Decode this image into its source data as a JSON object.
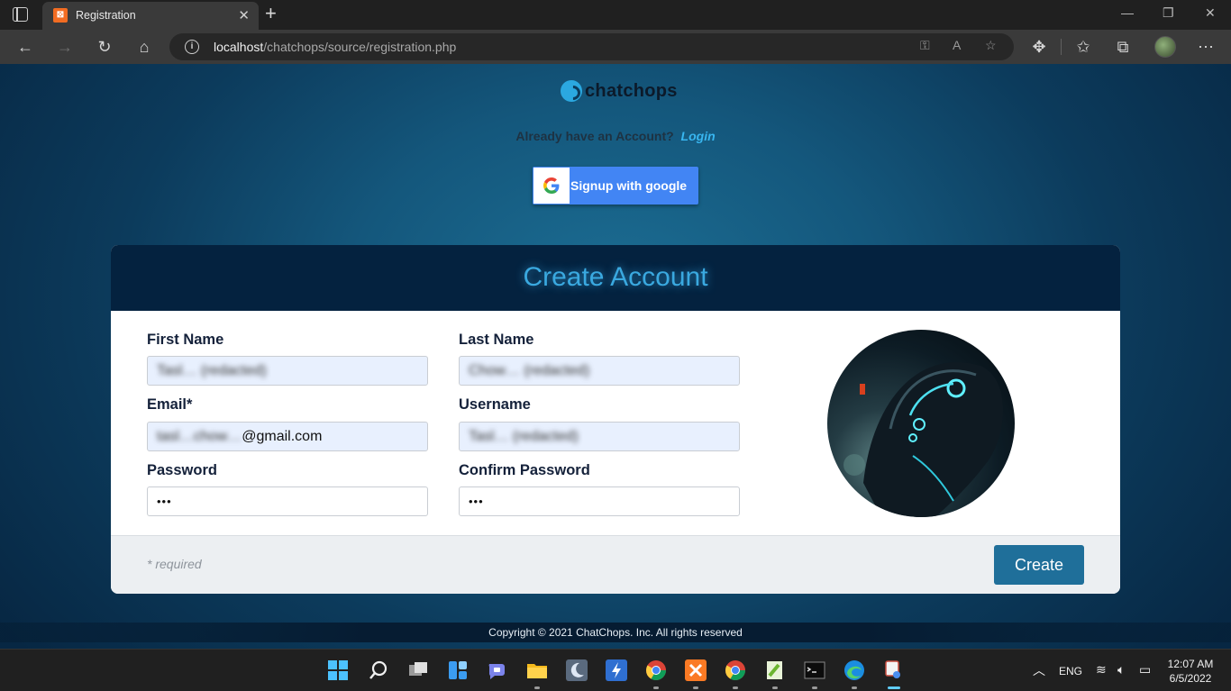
{
  "browser": {
    "tab_title": "Registration",
    "tab_favicon": "xampp-icon",
    "url_host": "localhost",
    "url_path": "/chatchops/source/registration.php",
    "new_tab_glyph": "+",
    "close_glyph": "✕"
  },
  "page": {
    "logo_text": "chatchops",
    "have_account_text": "Already have an Account?",
    "login_link": "Login",
    "google_button_label": "Signup with google",
    "card_title": "Create Account",
    "fields": {
      "first_name": {
        "label": "First Name",
        "value": "Tasl… (redacted)"
      },
      "last_name": {
        "label": "Last Name",
        "value": "Chow… (redacted)"
      },
      "email": {
        "label": "Email*",
        "value_blurred": "tasl…chow…",
        "value_visible": "@gmail.com"
      },
      "username": {
        "label": "Username",
        "value": "Tasl… (redacted)"
      },
      "password": {
        "label": "Password",
        "value": "•••"
      },
      "confirm_password": {
        "label": "Confirm Password",
        "value": "•••"
      }
    },
    "required_note": "* required",
    "create_button": "Create",
    "copyright": "Copyright © 2021 ChatChops. Inc. All rights reserved"
  },
  "taskbar": {
    "language": "ENG",
    "time": "12:07 AM",
    "date": "6/5/2022"
  },
  "colors": {
    "accent": "#3aa9e0",
    "google_blue": "#4285f4",
    "create_button": "#1f6f9a",
    "card_header": "#04223f",
    "input_autofill": "#e8f0fe"
  }
}
